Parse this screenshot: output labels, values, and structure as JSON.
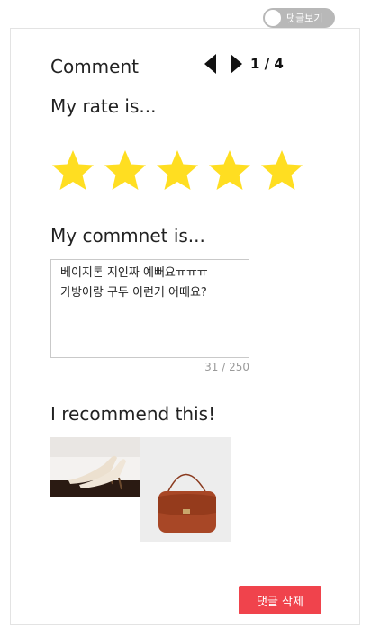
{
  "toggle": {
    "label": "댓글보기",
    "on": false
  },
  "comment": {
    "title": "Comment",
    "page_indicator": "1 / 4",
    "rate_heading": "My rate is...",
    "rating": 5,
    "rating_max": 5,
    "star_color": "#ffde21",
    "comment_heading": "My commnet is...",
    "comment_text": "베이지톤 지인짜 예뻐요ㅠㅠㅠ\n가방이랑 구두 이런거 어때요?",
    "char_count": "31 / 250",
    "recommend_heading": "I recommend this!",
    "recommendations": [
      {
        "icon": "shoes-image"
      },
      {
        "icon": "bag-image"
      }
    ],
    "delete_label": "댓글 삭제",
    "delete_color": "#f0434c"
  }
}
